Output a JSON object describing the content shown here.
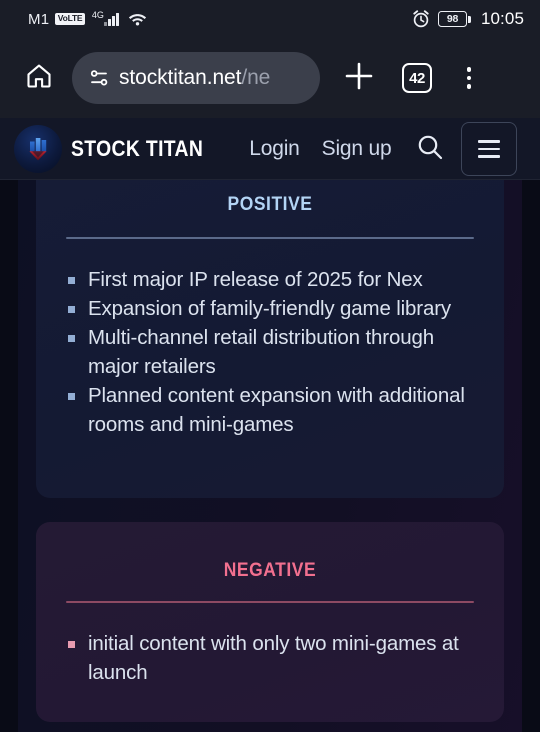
{
  "status_bar": {
    "carrier": "M1",
    "volte_badge": "VoLTE",
    "network_type": "4G",
    "signal_icon": "signal-bars-icon",
    "wifi_icon": "wifi-icon",
    "alarm_icon": "alarm-clock-icon",
    "battery_percent": "98",
    "time": "10:05"
  },
  "browser": {
    "home_icon": "home-icon",
    "site_settings_icon": "page-info-icon",
    "url_text": "stocktitan.net",
    "url_dim_text": "/ne",
    "new_tab_icon": "plus-icon",
    "tab_count": "42",
    "overflow_icon": "three-dot-menu-icon"
  },
  "site_header": {
    "logo_icon": "stock-titan-logo-icon",
    "brand_name": "STOCK TITAN",
    "nav": [
      {
        "label": "Login",
        "name": "nav-login"
      },
      {
        "label": "Sign up",
        "name": "nav-signup"
      }
    ],
    "search_icon": "search-icon",
    "menu_icon": "hamburger-menu-icon"
  },
  "content": {
    "positive_card": {
      "title": "Positive",
      "accent_color": "#b3d4f5",
      "bullets": [
        "First major IP release of 2025 for Nex",
        "Expansion of family-friendly game library",
        "Multi-channel retail distribution through major retailers",
        "Planned content expansion with additional rooms and mini-games"
      ]
    },
    "negative_card": {
      "title": "Negative",
      "accent_color": "#f2708f",
      "bullets": [
        "initial content with only two mini-games at launch"
      ]
    }
  }
}
